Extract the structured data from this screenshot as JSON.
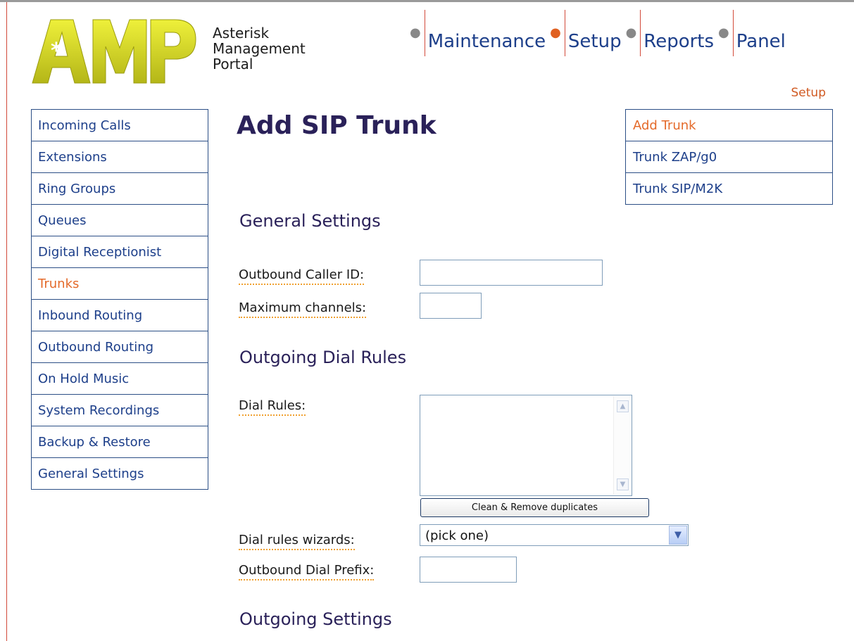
{
  "logo": {
    "letters": "AMP",
    "subtitle_line1": "Asterisk",
    "subtitle_line2": "Management",
    "subtitle_line3": "Portal"
  },
  "top_nav": [
    {
      "label": "Maintenance",
      "active": false
    },
    {
      "label": "Setup",
      "active": true
    },
    {
      "label": "Reports",
      "active": false
    },
    {
      "label": "Panel",
      "active": false
    }
  ],
  "section_label": "Setup",
  "sidebar": {
    "items": [
      {
        "label": "Incoming Calls"
      },
      {
        "label": "Extensions"
      },
      {
        "label": "Ring Groups"
      },
      {
        "label": "Queues"
      },
      {
        "label": "Digital Receptionist"
      },
      {
        "label": "Trunks",
        "active": true
      },
      {
        "label": "Inbound Routing"
      },
      {
        "label": "Outbound Routing"
      },
      {
        "label": "On Hold Music"
      },
      {
        "label": "System Recordings"
      },
      {
        "label": "Backup & Restore"
      },
      {
        "label": "General Settings"
      }
    ]
  },
  "subnav": {
    "items": [
      {
        "label": "Add Trunk",
        "active": true
      },
      {
        "label": "Trunk ZAP/g0"
      },
      {
        "label": "Trunk SIP/M2K"
      }
    ]
  },
  "main": {
    "title": "Add SIP Trunk",
    "general_heading": "General Settings",
    "caller_id_label": "Outbound Caller ID:",
    "caller_id_value": "",
    "max_channels_label": "Maximum channels:",
    "max_channels_value": "",
    "dial_rules_heading": "Outgoing Dial Rules",
    "dial_rules_label": "Dial Rules:",
    "dial_rules_value": "",
    "clean_button_label": "Clean & Remove duplicates",
    "wizard_label": "Dial rules wizards:",
    "wizard_selected": "(pick one)",
    "prefix_label": "Outbound Dial Prefix:",
    "prefix_value": "",
    "outgoing_heading": "Outgoing Settings"
  },
  "colors": {
    "link": "#1d3f8a",
    "active": "#e46a2a",
    "heading": "#2a2159",
    "border": "#2c4f86",
    "logo_fill": "#d6d82a"
  }
}
